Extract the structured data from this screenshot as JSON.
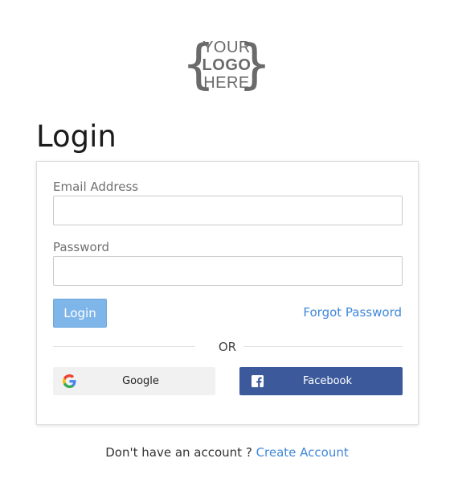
{
  "logo": {
    "brace_left": "{",
    "line1": "YOUR",
    "line2": "LOGO",
    "line3": "HERE",
    "brace_right": "}"
  },
  "page_title": "Login",
  "form": {
    "email_label": "Email Address",
    "email_value": "",
    "password_label": "Password",
    "password_value": "",
    "login_button": "Login",
    "forgot_link": "Forgot Password",
    "or_text": "OR",
    "google_button": "Google",
    "facebook_button": "Facebook"
  },
  "footer": {
    "prompt": "Don't have an account ? ",
    "create_link": "Create Account"
  },
  "icons": {
    "google": "google-icon",
    "facebook": "facebook-icon"
  },
  "colors": {
    "accent": "#3f87d9",
    "login_button_bg": "#7fb6ea",
    "facebook_bg": "#3c5a9b",
    "google_bg": "#f1f1f1",
    "logo_gray": "#6a6a6a"
  }
}
